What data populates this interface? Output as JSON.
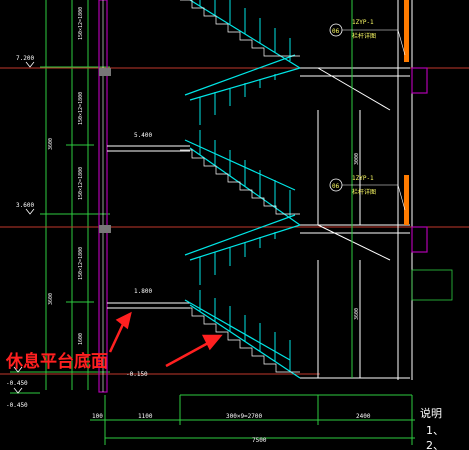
{
  "drawing": {
    "annotation": "休息平台底面",
    "note_title": "说明",
    "note_items": [
      "1、",
      "2、"
    ],
    "elevations": {
      "e7200": "7.200",
      "e5400": "5.400",
      "e3600": "3.600",
      "e1800": "1.800",
      "em0150": "-0.150",
      "em0450": "-0.450"
    },
    "dims": {
      "d3600a": "3600",
      "d3600b": "3600",
      "d3600c": "3600",
      "d3600d": "3600",
      "d3000": "3000",
      "d2400": "2400",
      "d1600": "1600",
      "run": "300×9=2700",
      "total": "7500",
      "d100": "100",
      "d1100": "1100"
    },
    "stair_riser_labels": [
      "150×12=1800",
      "150×12=1800",
      "150×12=1800",
      "150×12=1800"
    ],
    "handrail_labels": [
      "1ZYP-1",
      "1ZYP-1"
    ],
    "handrail_sublabels": [
      "栏杆详图",
      "栏杆详图"
    ],
    "circle_labels": [
      "06",
      "06"
    ],
    "colors": {
      "background": "#000000",
      "stair": "#00e5e5",
      "structure": "#ffffff",
      "level_line": "#c0392b",
      "dim_line": "#2ecc40",
      "column": "#b000b0",
      "annotation": "#ff2020"
    }
  }
}
